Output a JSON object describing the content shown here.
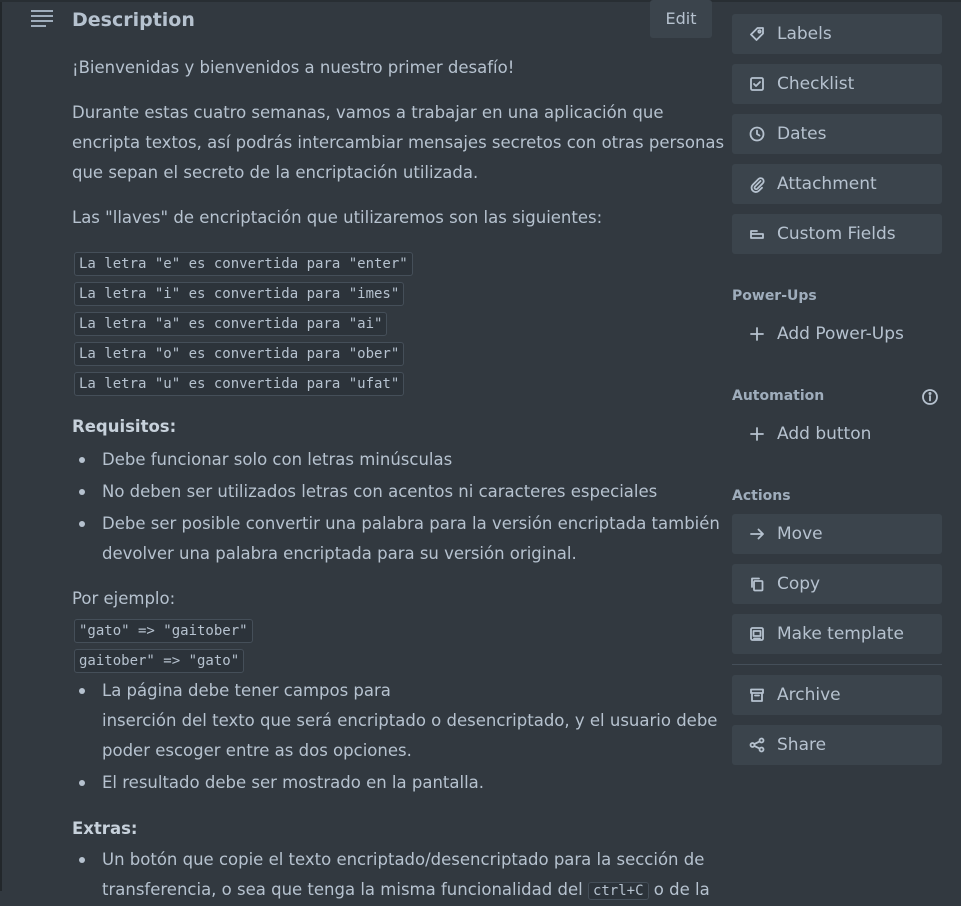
{
  "description": {
    "title": "Description",
    "edit_label": "Edit",
    "intro": "¡Bienvenidas y bienvenidos a nuestro primer desafío!",
    "para1": [
      "Durante estas cuatro semanas, vamos a trabajar en una aplicación que",
      "encripta textos, así podrás intercambiar mensajes secretos con otras personas",
      "que sepan el secreto de la encriptación utilizada."
    ],
    "keys_intro": "Las \"llaves\" de encriptación que utilizaremos son las siguientes:",
    "keys": [
      "La letra \"e\" es convertida para \"enter\"",
      "La letra \"i\" es convertida para \"imes\"",
      "La letra \"a\" es convertida para \"ai\"",
      "La letra \"o\" es convertida para \"ober\"",
      "La letra \"u\" es convertida para \"ufat\""
    ],
    "requisitos_heading": "Requisitos:",
    "requisitos": [
      "Debe funcionar solo con letras minúsculas",
      "No deben ser utilizados letras con acentos ni caracteres especiales",
      "Debe ser posible convertir una palabra para la versión encriptada también",
      "devolver una palabra encriptada para su versión original."
    ],
    "ejemplo_label": "Por ejemplo:",
    "ejemplos": [
      "\"gato\" => \"gaitober\"",
      "gaitober\" => \"gato\""
    ],
    "more_reqs": [
      "La página debe tener campos para",
      "inserción del texto que será encriptado o desencriptado, y el usuario debe",
      "poder escoger entre as dos opciones.",
      "El resultado debe ser mostrado en la pantalla."
    ],
    "extras_heading": "Extras:",
    "extras": [
      "Un botón que copie el texto encriptado/desencriptado para la sección de",
      "transferencia, o sea que tenga la misma funcionalidad del",
      "ctrl+C",
      "o de la"
    ]
  },
  "sidebar": {
    "add_to_card": [
      {
        "label": "Labels",
        "icon": "tag-icon"
      },
      {
        "label": "Checklist",
        "icon": "checklist-icon"
      },
      {
        "label": "Dates",
        "icon": "clock-icon"
      },
      {
        "label": "Attachment",
        "icon": "paperclip-icon"
      },
      {
        "label": "Custom Fields",
        "icon": "custom-fields-icon"
      }
    ],
    "powerups_heading": "Power-Ups",
    "add_powerups": "Add Power-Ups",
    "automation_heading": "Automation",
    "add_button": "Add button",
    "actions_heading": "Actions",
    "actions": [
      {
        "label": "Move",
        "icon": "arrow-right-icon"
      },
      {
        "label": "Copy",
        "icon": "copy-icon"
      },
      {
        "label": "Make template",
        "icon": "template-icon"
      },
      {
        "label": "Archive",
        "icon": "archive-icon"
      },
      {
        "label": "Share",
        "icon": "share-icon"
      }
    ]
  }
}
